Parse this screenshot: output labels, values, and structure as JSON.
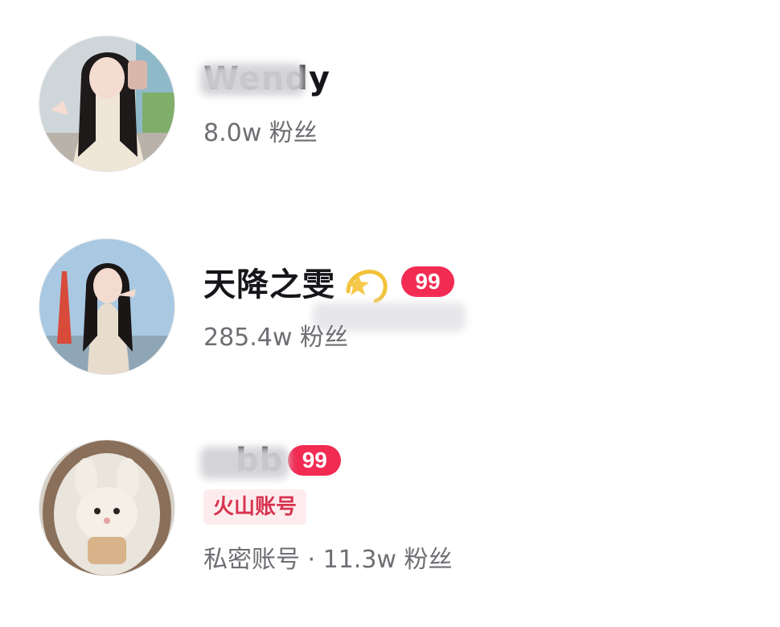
{
  "accounts": [
    {
      "name": "Wendy",
      "followers_text": "8.0w 粉丝",
      "badge": "",
      "tag": ""
    },
    {
      "name": "天降之雯",
      "emoji": "sparkle-star",
      "badge": "99",
      "followers_text": "285.4w 粉丝"
    },
    {
      "name": "bb",
      "badge": "99",
      "tag": "火山账号",
      "followers_text": "私密账号 · 11.3w 粉丝"
    }
  ],
  "colors": {
    "badge_bg": "#f22b53",
    "tag_bg": "#fdecee",
    "tag_text": "#d7334f",
    "secondary_text": "#6e6e73"
  }
}
